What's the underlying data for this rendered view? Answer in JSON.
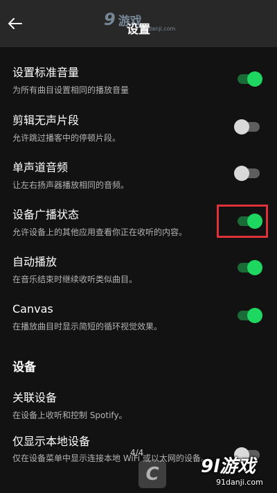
{
  "header": {
    "title": "设置",
    "back_icon": "arrow-left-icon",
    "watermark": {
      "logo": "9",
      "text": "游戏",
      "url": "91danji.com"
    }
  },
  "colors": {
    "accent": "#1ed760",
    "background": "#121212",
    "header": "#282828",
    "highlight": "#e0303a"
  },
  "settings": [
    {
      "title": "设置标准音量",
      "desc": "为所有曲目设置相同的播放音量",
      "enabled": true
    },
    {
      "title": "剪辑无声片段",
      "desc": "允许跳过播客中的停顿片段。",
      "enabled": false
    },
    {
      "title": "单声道音频",
      "desc": "让左右扬声器播放相同的音频。",
      "enabled": false
    },
    {
      "title": "设备广播状态",
      "desc": "允许设备上的其他应用查看你正在收听的内容。",
      "enabled": true
    },
    {
      "title": "自动播放",
      "desc": "在音乐结束时继续收听类似曲目。",
      "enabled": true
    },
    {
      "title": "Canvas",
      "desc": "在播放曲目时显示简短的循环视觉效果。",
      "enabled": true
    }
  ],
  "devices_section": {
    "heading": "设备",
    "items": [
      {
        "title": "关联设备",
        "desc": "在设备上收听和控制 Spotify。"
      },
      {
        "title": "仅显示本地设备",
        "desc": "仅在设备菜单中显示连接本地 WiFi 或以太网的设备。",
        "enabled": false
      }
    ]
  },
  "overlay": {
    "page_indicator": "4/4",
    "brand": "9l游戏",
    "site": "91danji.com",
    "cz": "C"
  }
}
